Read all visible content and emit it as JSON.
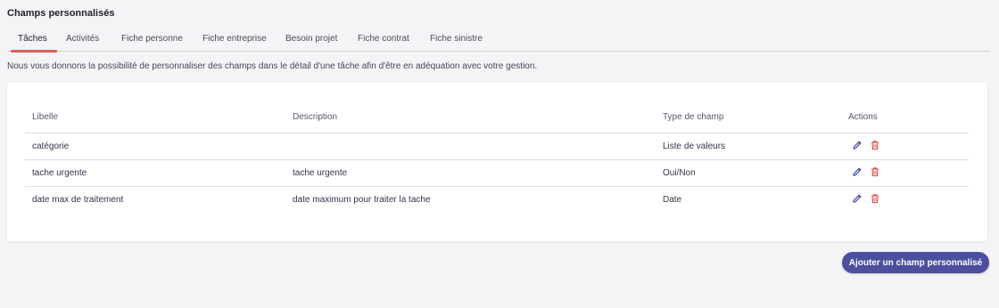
{
  "page": {
    "title": "Champs personnalisés"
  },
  "tabs": [
    {
      "label": "Tâches",
      "active": true
    },
    {
      "label": "Activités",
      "active": false
    },
    {
      "label": "Fiche personne",
      "active": false
    },
    {
      "label": "Fiche entreprise",
      "active": false
    },
    {
      "label": "Besoin projet",
      "active": false
    },
    {
      "label": "Fiche contrat",
      "active": false
    },
    {
      "label": "Fiche sinistre",
      "active": false
    }
  ],
  "intro": "Nous vous donnons la possibilité de personnaliser des champs dans le détail d'une tâche afin d'être en adéquation avec votre gestion.",
  "table": {
    "headers": {
      "libelle": "Libelle",
      "description": "Description",
      "type": "Type de champ",
      "actions": "Actions"
    },
    "rows": [
      {
        "libelle": "catégorie",
        "description": "",
        "type": "Liste de valeurs"
      },
      {
        "libelle": "tache urgente",
        "description": "tache urgente",
        "type": "Oui/Non"
      },
      {
        "libelle": "date max de traitement",
        "description": "date maximum pour traiter la tache",
        "type": "Date"
      }
    ],
    "row_actions": [
      {
        "icon": "pencil-icon",
        "color": "#3f48a8"
      },
      {
        "icon": "trash-icon",
        "color": "#e2463f"
      }
    ]
  },
  "add_button": {
    "label": "Ajouter un champ personnalisé"
  },
  "colors": {
    "accent": "#4b4f9e",
    "tab_underline": "#e35d5a",
    "delete": "#e2463f",
    "edit": "#3f48a8"
  }
}
